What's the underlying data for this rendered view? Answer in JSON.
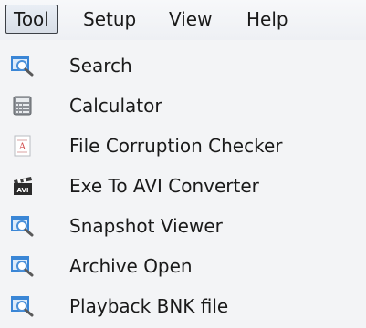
{
  "menubar": {
    "items": [
      {
        "label": "Tool",
        "active": true
      },
      {
        "label": "Setup",
        "active": false
      },
      {
        "label": "View",
        "active": false
      },
      {
        "label": "Help",
        "active": false
      }
    ]
  },
  "dropdown": {
    "items": [
      {
        "label": "Search",
        "icon": "magnifier-window-icon"
      },
      {
        "label": "Calculator",
        "icon": "calculator-icon"
      },
      {
        "label": "File Corruption Checker",
        "icon": "document-check-icon"
      },
      {
        "label": "Exe To AVI Converter",
        "icon": "clapperboard-avi-icon"
      },
      {
        "label": "Snapshot Viewer",
        "icon": "magnifier-window-icon"
      },
      {
        "label": "Archive Open",
        "icon": "magnifier-window-icon"
      },
      {
        "label": "Playback BNK file",
        "icon": "magnifier-window-icon"
      }
    ]
  },
  "colors": {
    "text": "#1a1a1a",
    "menu_background": "#f3f4f6",
    "active_border": "#3b3f45",
    "icon_blue": "#3a86d6"
  }
}
